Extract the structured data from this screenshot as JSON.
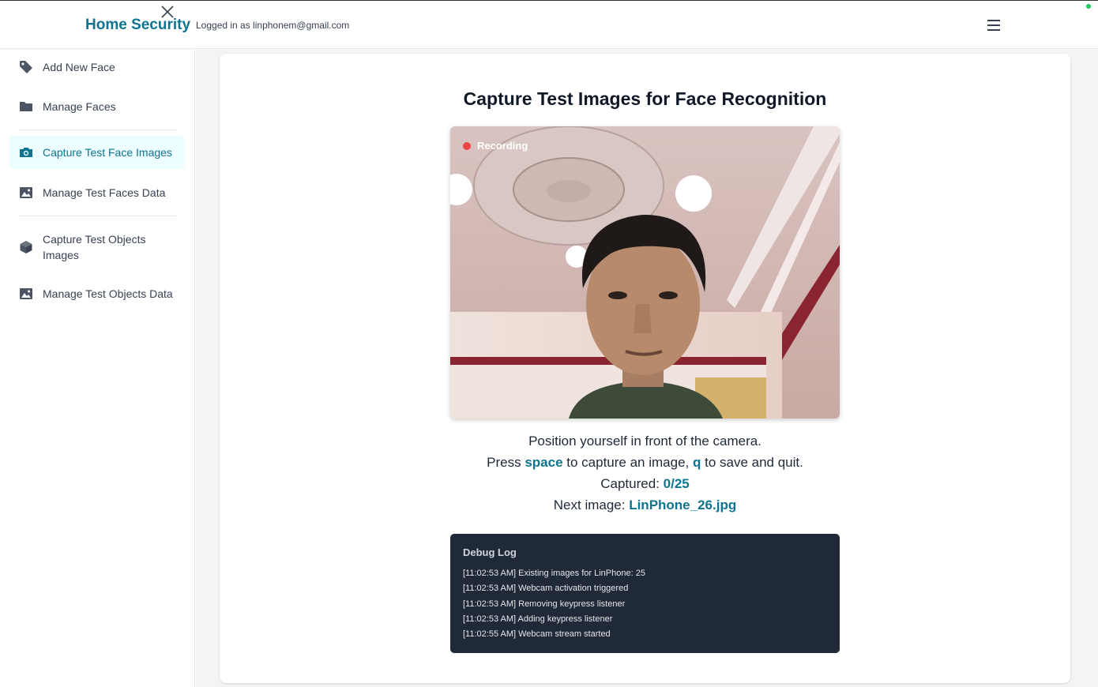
{
  "header": {
    "brand": "Home Security",
    "logged_in_text": "Logged in as linphonem@gmail.com"
  },
  "sidebar": {
    "items": [
      {
        "label": "Add New Face",
        "icon": "tag-icon"
      },
      {
        "label": "Manage Faces",
        "icon": "folder-icon"
      },
      {
        "label": "Capture Test Face Images",
        "icon": "camera-icon",
        "active": true
      },
      {
        "label": "Manage Test Faces Data",
        "icon": "image-icon"
      },
      {
        "label": "Capture Test Objects Images",
        "icon": "cube-icon"
      },
      {
        "label": "Manage Test Objects Data",
        "icon": "image-icon"
      }
    ]
  },
  "main": {
    "title": "Capture Test Images for Face Recognition",
    "recording_label": "Recording",
    "instructions": {
      "line1": "Position yourself in front of the camera.",
      "press": "Press",
      "space_key": "space",
      "capture_text": "to capture an image,",
      "q_key": "q",
      "save_text": "to save and quit.",
      "captured_label": "Captured:",
      "captured_value": "0/25",
      "next_label": "Next image:",
      "next_value": "LinPhone_26.jpg"
    },
    "debug": {
      "title": "Debug Log",
      "lines": [
        "[11:02:53 AM] Existing images for LinPhone: 25",
        "[11:02:53 AM] Webcam activation triggered",
        "[11:02:53 AM] Removing keypress listener",
        "[11:02:53 AM] Adding keypress listener",
        "[11:02:55 AM] Webcam stream started"
      ]
    }
  },
  "colors": {
    "accent": "#0e7490",
    "active_bg": "#ecfeff",
    "recording_dot": "#ef4444",
    "debug_bg": "#1f2937"
  }
}
